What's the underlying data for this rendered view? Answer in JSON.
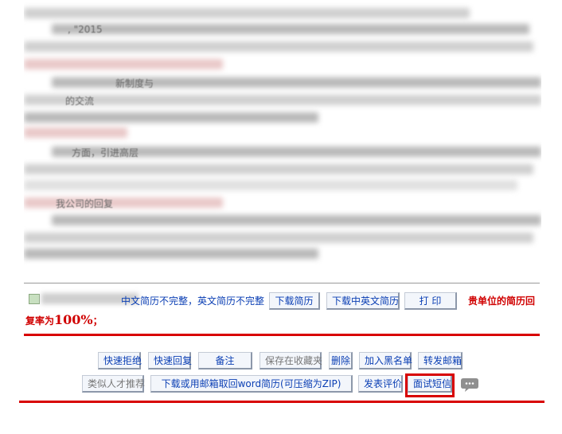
{
  "content": {
    "ghost_texts": [
      ", \"2015",
      "新制度与",
      "的交流",
      "方面，引进高层",
      "我公司的回复"
    ]
  },
  "status_row": {
    "resume_status": "中文简历不完整，英文简历不完整",
    "buttons": {
      "download_resume": "下载简历",
      "download_cn_en": "下载中英文简历",
      "print": "打  印"
    },
    "reply_rate_prefix": "贵单位的简历回",
    "reply_rate_label": "复率为",
    "reply_rate_value": "100%",
    "reply_rate_suffix": "；"
  },
  "actions": {
    "row1": {
      "quick_reject": "快速拒绝",
      "quick_reply": "快速回复",
      "note": "备注",
      "save_favorites": "保存在收藏夹",
      "delete": "删除",
      "add_blacklist": "加入黑名单",
      "forward_email": "转发邮箱"
    },
    "row2": {
      "similar_talent": "类似人才推荐",
      "download_word": "下载或用邮箱取回word简历(可压缩为ZIP)",
      "post_review": "发表评价",
      "interview_sms": "面试短信"
    }
  },
  "colors": {
    "accent_blue": "#0b3fb4",
    "alert_red": "#d80000",
    "divider_gray": "#9a9a9a"
  },
  "icons": {
    "chat": "chat-bubble-icon",
    "checkbox": "checkbox-icon"
  }
}
